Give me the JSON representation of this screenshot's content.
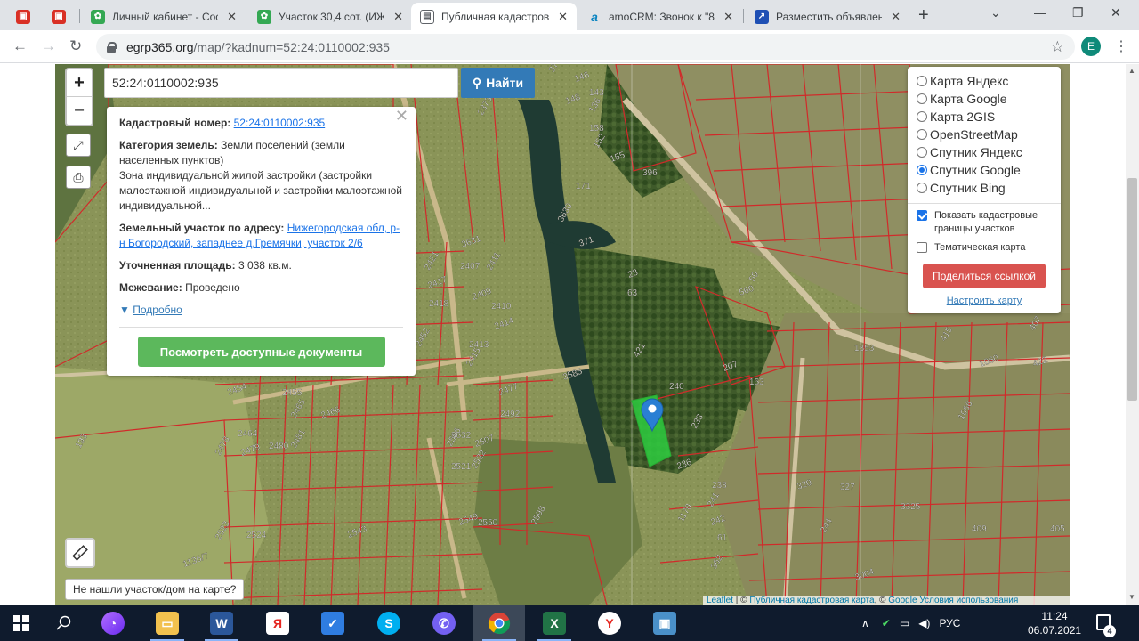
{
  "browser": {
    "tabs": [
      {
        "title": "",
        "fav_color": "#d93025",
        "fav_glyph": "▣"
      },
      {
        "title": "",
        "fav_color": "#d93025",
        "fav_glyph": "▣"
      },
      {
        "title": "Личный кабинет - Сос",
        "fav_color": "#34a853",
        "fav_glyph": "✿"
      },
      {
        "title": "Участок 30,4 сот. (ИЖС",
        "fav_color": "#34a853",
        "fav_glyph": "✿"
      },
      {
        "title": "Публичная кадастрова",
        "fav_color": "#5f6368",
        "fav_glyph": "▤"
      },
      {
        "title": "amoCRM: Звонок к \"89",
        "fav_color": "#0a84c1",
        "fav_glyph": "a"
      },
      {
        "title": "Разместить объявлени",
        "fav_color": "#1e4fb4",
        "fav_glyph": "↗"
      }
    ],
    "url_host": "egrp365.org",
    "url_path": "/map/?kadnum=52:24:0110002:935",
    "profile_initial": "E"
  },
  "search": {
    "value": "52:24:0110002:935",
    "button_label": "Найти"
  },
  "popup": {
    "cadnum_label": "Кадастровый номер:",
    "cadnum_value": "52:24:0110002:935",
    "category_label": "Категория земель:",
    "category_value": "Земли поселений (земли населенных пунктов)",
    "zone_text": "Зона индивидуальной жилой застройки (застройки малоэтажной индивидуальной и застройки малоэтажной индивидуальной...",
    "address_label": "Земельный участок по адресу:",
    "address_value": "Нижегородская обл, р-н Богородский, западнее д.Гремячки, участок 2/6",
    "area_label": "Уточненная площадь:",
    "area_value": "3 038 кв.м.",
    "survey_label": "Межевание:",
    "survey_value": "Проведено",
    "more_label": "Подробно",
    "docs_button": "Посмотреть доступные документы"
  },
  "layers": {
    "options": [
      {
        "label": "Карта Яндекс",
        "selected": false
      },
      {
        "label": "Карта Google",
        "selected": false
      },
      {
        "label": "Карта 2GIS",
        "selected": false
      },
      {
        "label": "OpenStreetMap",
        "selected": false
      },
      {
        "label": "Спутник Яндекс",
        "selected": false
      },
      {
        "label": "Спутник Google",
        "selected": true
      },
      {
        "label": "Спутник Bing",
        "selected": false
      }
    ],
    "show_borders_label": "Показать кадастровые границы участков",
    "show_borders_checked": true,
    "thematic_label": "Тематическая карта",
    "thematic_checked": false,
    "share_button": "Поделиться ссылкой",
    "settings_link": "Настроить карту"
  },
  "map": {
    "not_found_label": "Не нашли участок/дом на карте?",
    "attribution_leaflet": "Leaflet",
    "attribution_map": "Публичная кадастровая карта",
    "attribution_google": "Google",
    "attribution_terms": "Условия использования",
    "parcel_labels": [
      "373",
      "146",
      "143",
      "136",
      "148",
      "158",
      "152",
      "155",
      "171",
      "2373/2",
      "371",
      "396",
      "3630",
      "3631",
      "2407",
      "2421",
      "2417",
      "2418",
      "2411",
      "2414",
      "2413",
      "2415",
      "2409",
      "2410",
      "2452",
      "2454",
      "2455",
      "2465",
      "2466",
      "2464",
      "2478",
      "2479",
      "2480",
      "2481",
      "2477",
      "2492",
      "2506",
      "2507",
      "2521",
      "2522",
      "2549",
      "2550",
      "2598",
      "2543",
      "2524",
      "2523",
      "3585",
      "3632",
      "193",
      "1136/7",
      "240",
      "233",
      "236",
      "238",
      "241",
      "242",
      "61",
      "362",
      "207",
      "163",
      "59",
      "560",
      "1353",
      "1066",
      "1060",
      "409",
      "407",
      "422",
      "405",
      "415",
      "320",
      "327",
      "244",
      "3004",
      "3325",
      "1170",
      "23",
      "63",
      "421"
    ],
    "marker_color": "#2a7fd4"
  },
  "taskbar": {
    "apps": [
      "start",
      "search",
      "cortana",
      "explorer",
      "word",
      "yandex-browser",
      "todo",
      "skype",
      "viber",
      "chrome",
      "excel",
      "yandex",
      "network"
    ],
    "lang": "РУС",
    "time": "11:24",
    "date": "06.07.2021",
    "notifications": "4"
  }
}
